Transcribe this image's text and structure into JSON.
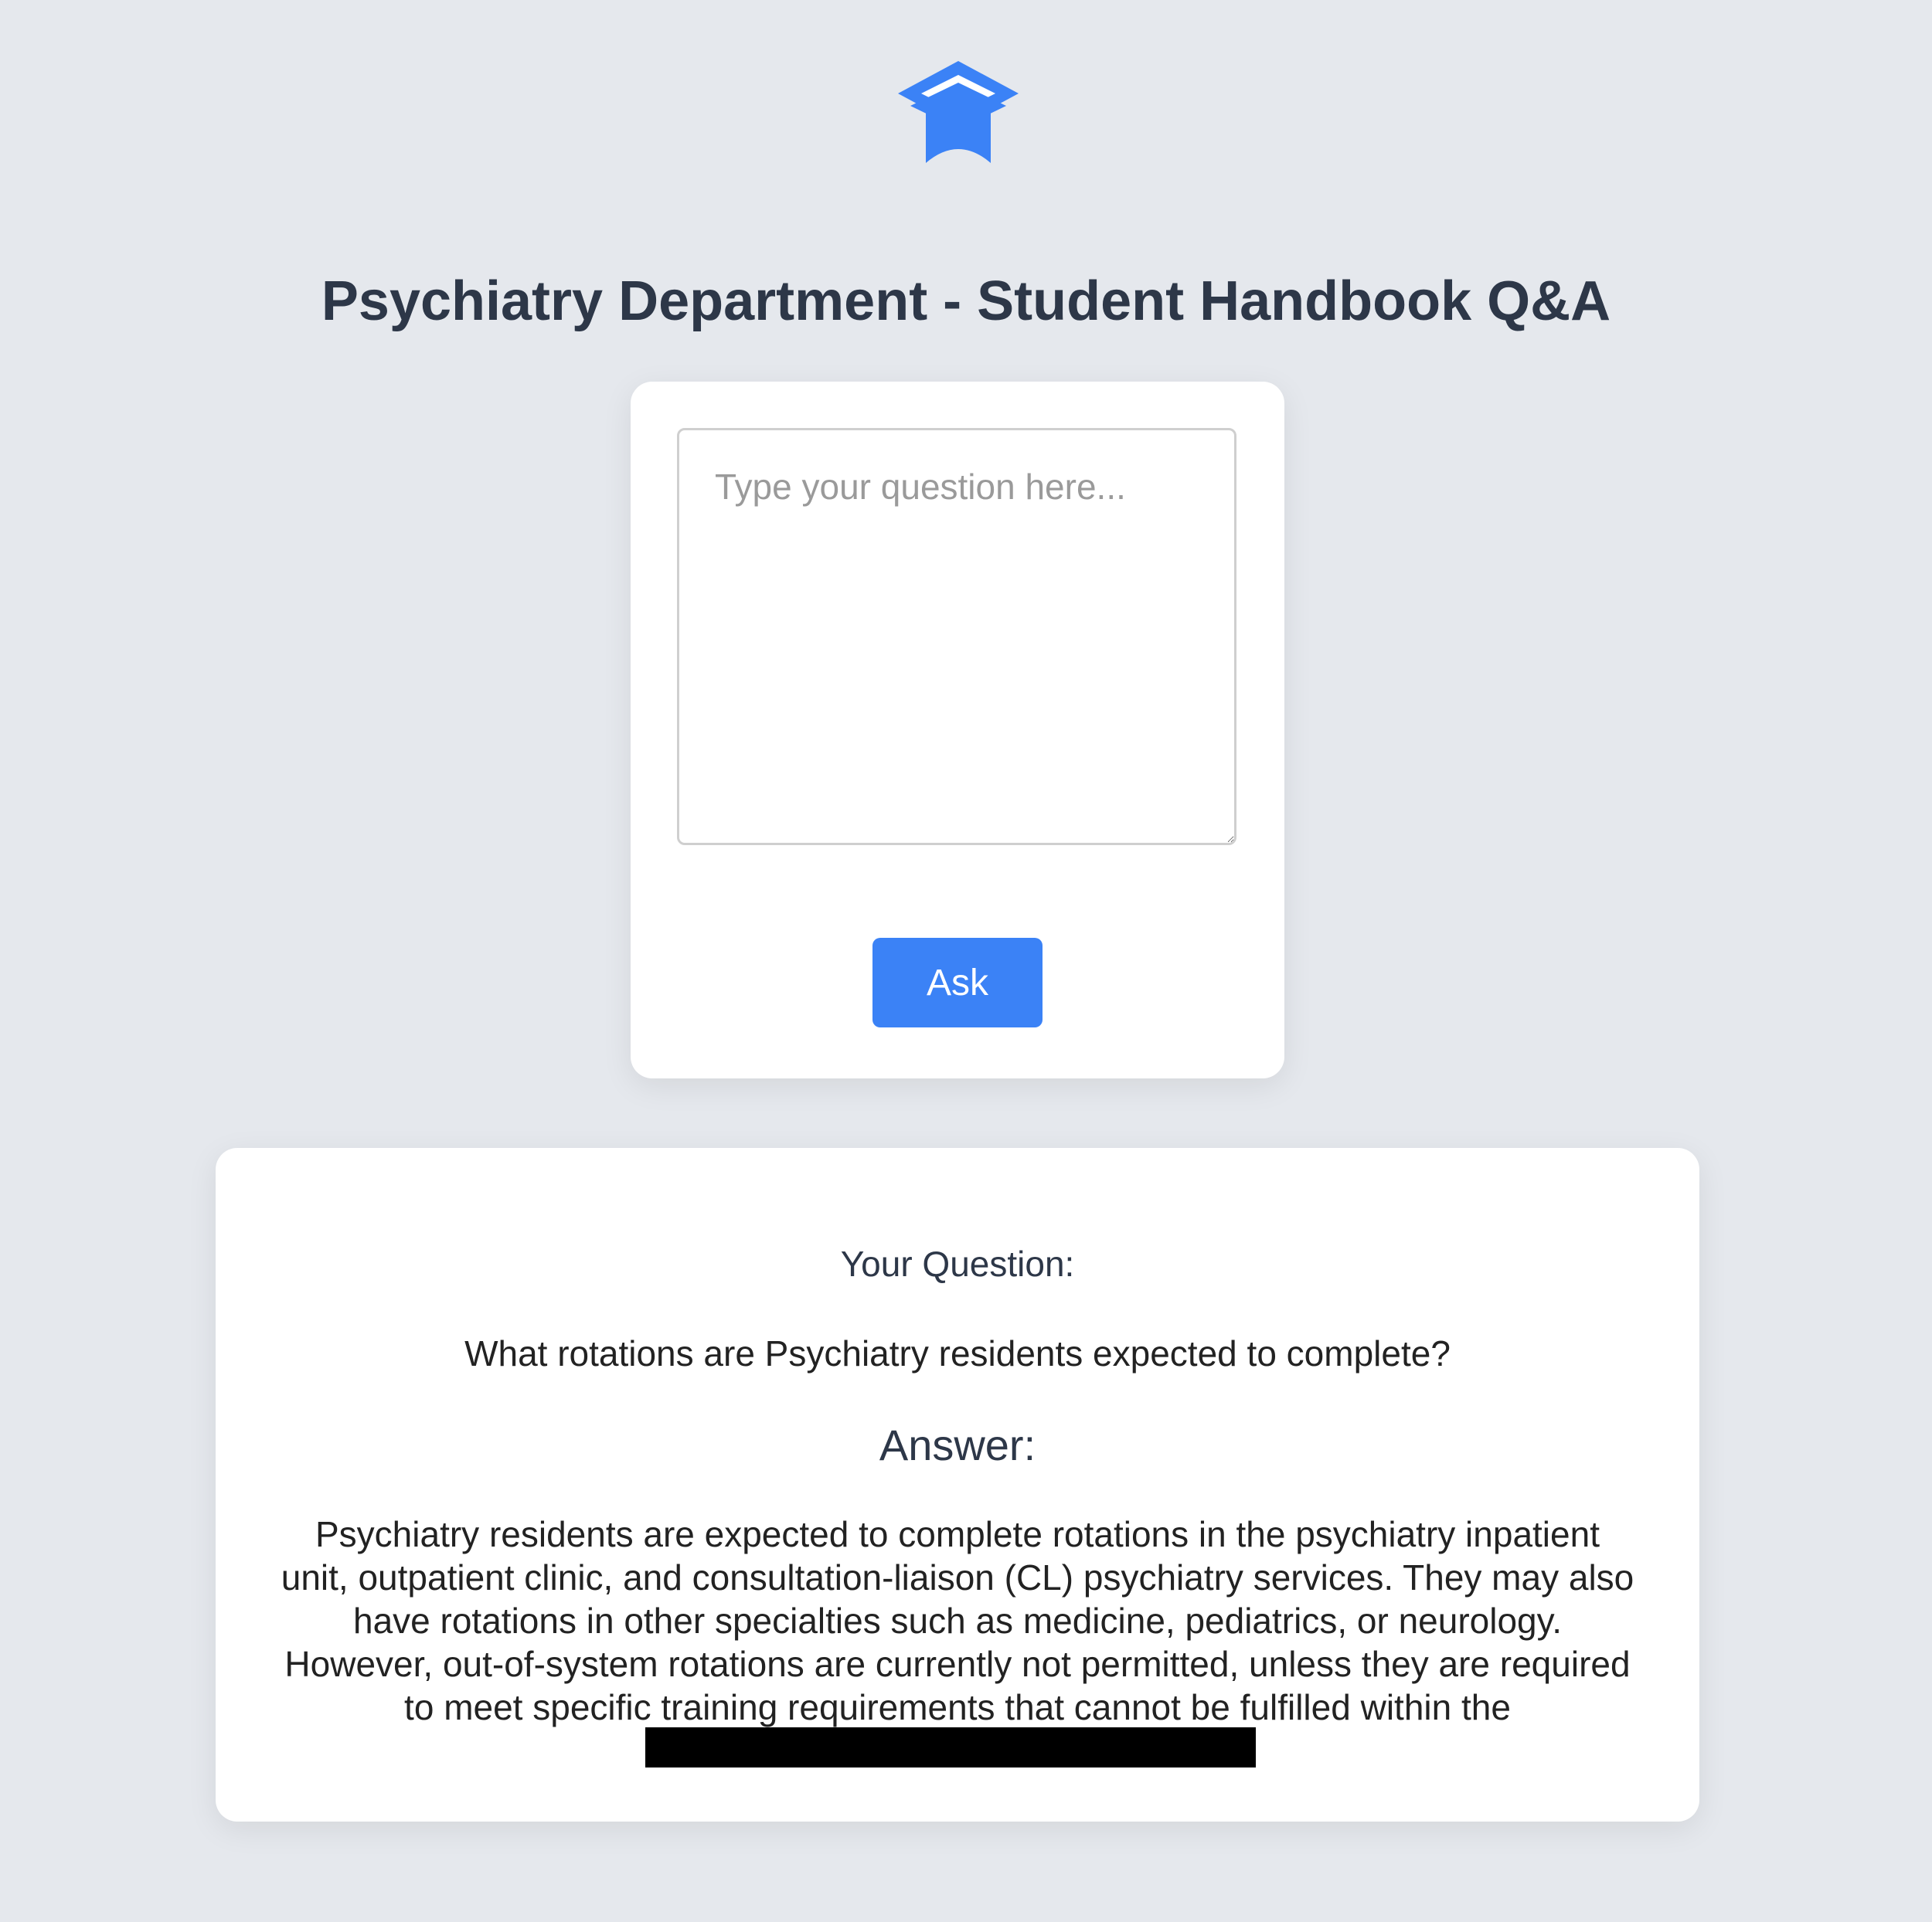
{
  "header": {
    "logo_icon": "graduation-cap-icon",
    "title": "Psychiatry Department - Student Handbook Q&A"
  },
  "ask_form": {
    "question_value": "",
    "question_placeholder": "Type your question here...",
    "ask_label": "Ask"
  },
  "result": {
    "question_heading": "Your Question:",
    "question_text": "What rotations are Psychiatry residents expected to complete?",
    "answer_heading": "Answer:",
    "answer_text": "Psychiatry residents are expected to complete rotations in the psychiatry inpatient unit, outpatient clinic, and consultation-liaison (CL) psychiatry services. They may also have rotations in other specialties such as medicine, pediatrics, or neurology. However, out-of-system rotations are currently not permitted, unless they are required to meet specific training requirements that cannot be fulfilled within the"
  },
  "colors": {
    "accent": "#3b82f6",
    "background": "#e5e8ed",
    "heading": "#2d3748",
    "redaction": "#000000"
  }
}
